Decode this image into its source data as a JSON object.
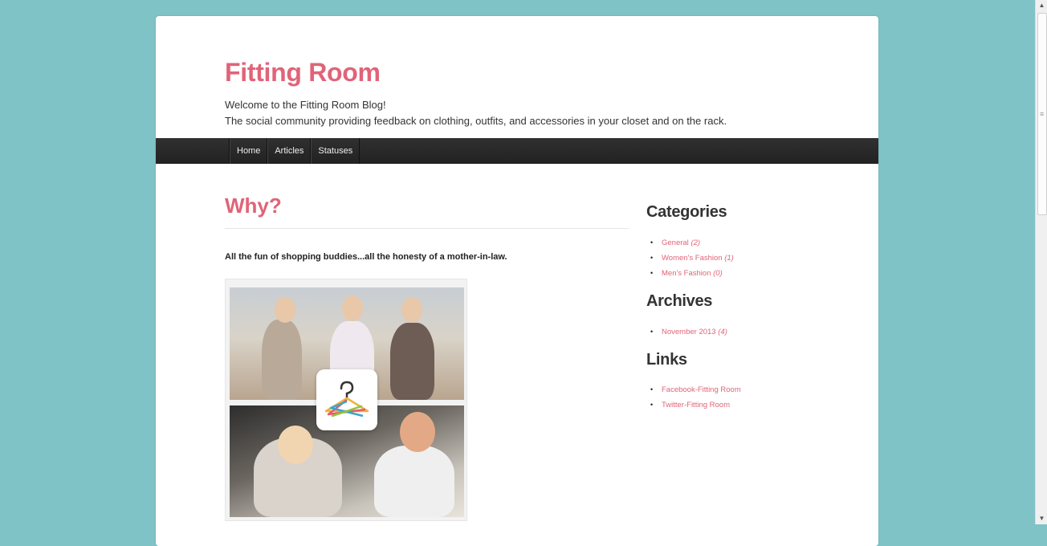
{
  "header": {
    "site_title": "Fitting Room",
    "tagline_line1": "Welcome to the Fitting Room Blog!",
    "tagline_line2": "The social community providing feedback on clothing, outfits, and accessories in your closet and on the rack."
  },
  "nav": {
    "items": [
      {
        "label": "Home"
      },
      {
        "label": "Articles"
      },
      {
        "label": "Statuses"
      }
    ]
  },
  "post": {
    "title": "Why?",
    "lead": "All the fun of shopping buddies...all the honesty of a mother-in-law.",
    "image_icon": "hanger-question-icon"
  },
  "sidebar": {
    "categories_heading": "Categories",
    "categories": [
      {
        "label": "General",
        "count": "(2)"
      },
      {
        "label": "Women's Fashion",
        "count": "(1)"
      },
      {
        "label": "Men's Fashion",
        "count": "(0)"
      }
    ],
    "archives_heading": "Archives",
    "archives": [
      {
        "label": "November 2013",
        "count": "(4)"
      }
    ],
    "links_heading": "Links",
    "links": [
      {
        "label": "Facebook-Fitting Room"
      },
      {
        "label": "Twitter-Fitting Room"
      }
    ]
  },
  "colors": {
    "accent": "#e06478",
    "background": "#7fc3c7",
    "navbar": "#272727"
  }
}
